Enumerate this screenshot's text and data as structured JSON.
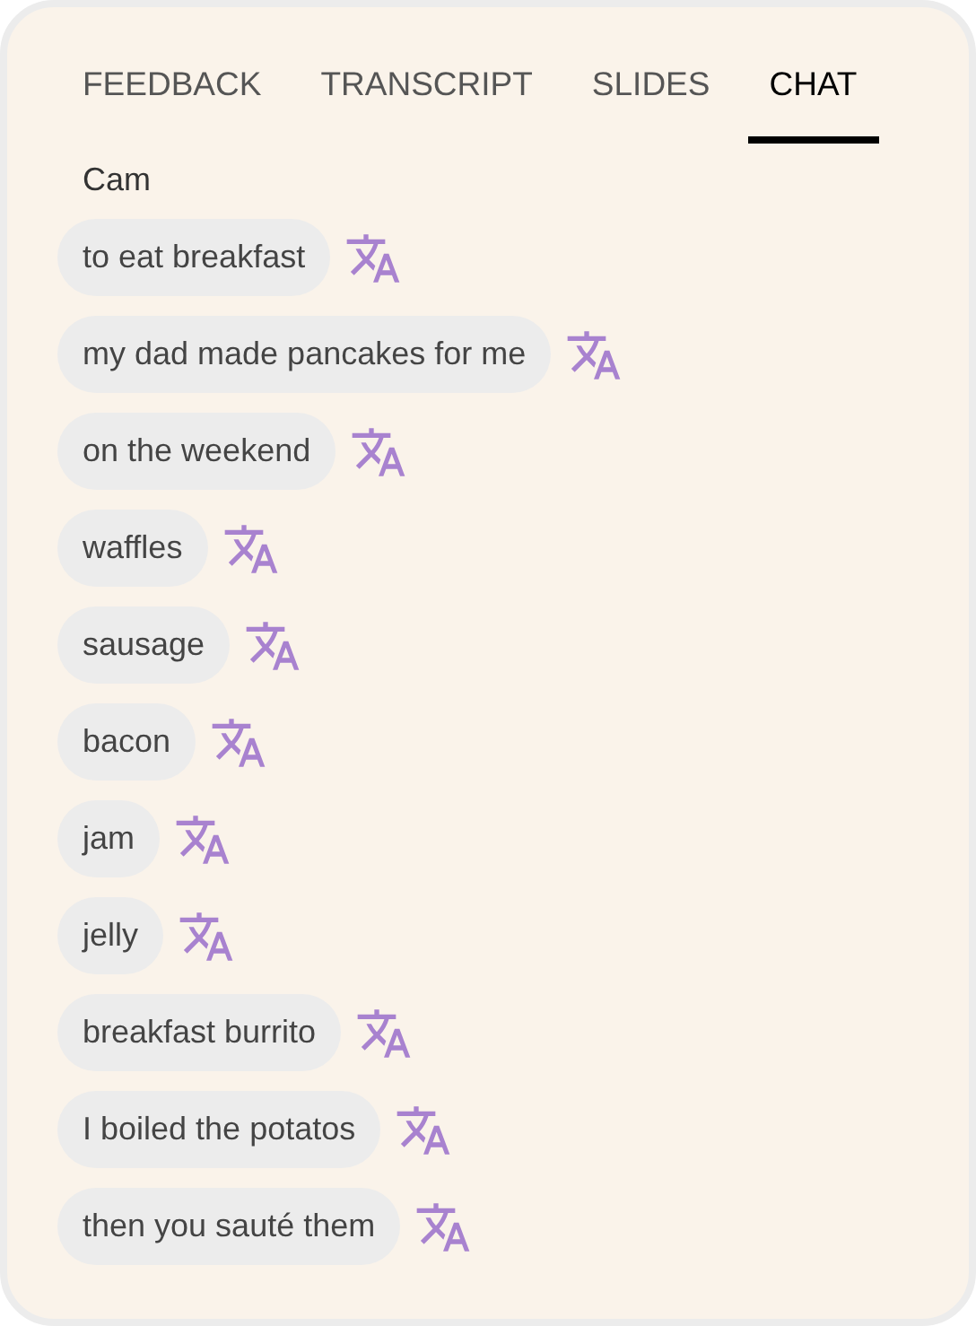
{
  "tabs": [
    {
      "label": "FEEDBACK",
      "selected": false
    },
    {
      "label": "TRANSCRIPT",
      "selected": false
    },
    {
      "label": "SLIDES",
      "selected": false
    },
    {
      "label": "CHAT",
      "selected": true
    }
  ],
  "chat": {
    "author": "Cam",
    "messages": [
      {
        "text": "to eat breakfast"
      },
      {
        "text": "my dad made pancakes for me"
      },
      {
        "text": "on the weekend"
      },
      {
        "text": "waffles"
      },
      {
        "text": "sausage"
      },
      {
        "text": "bacon"
      },
      {
        "text": "jam"
      },
      {
        "text": "jelly"
      },
      {
        "text": "breakfast burrito"
      },
      {
        "text": "I boiled the potatos"
      },
      {
        "text": "then you sauté them"
      }
    ]
  }
}
